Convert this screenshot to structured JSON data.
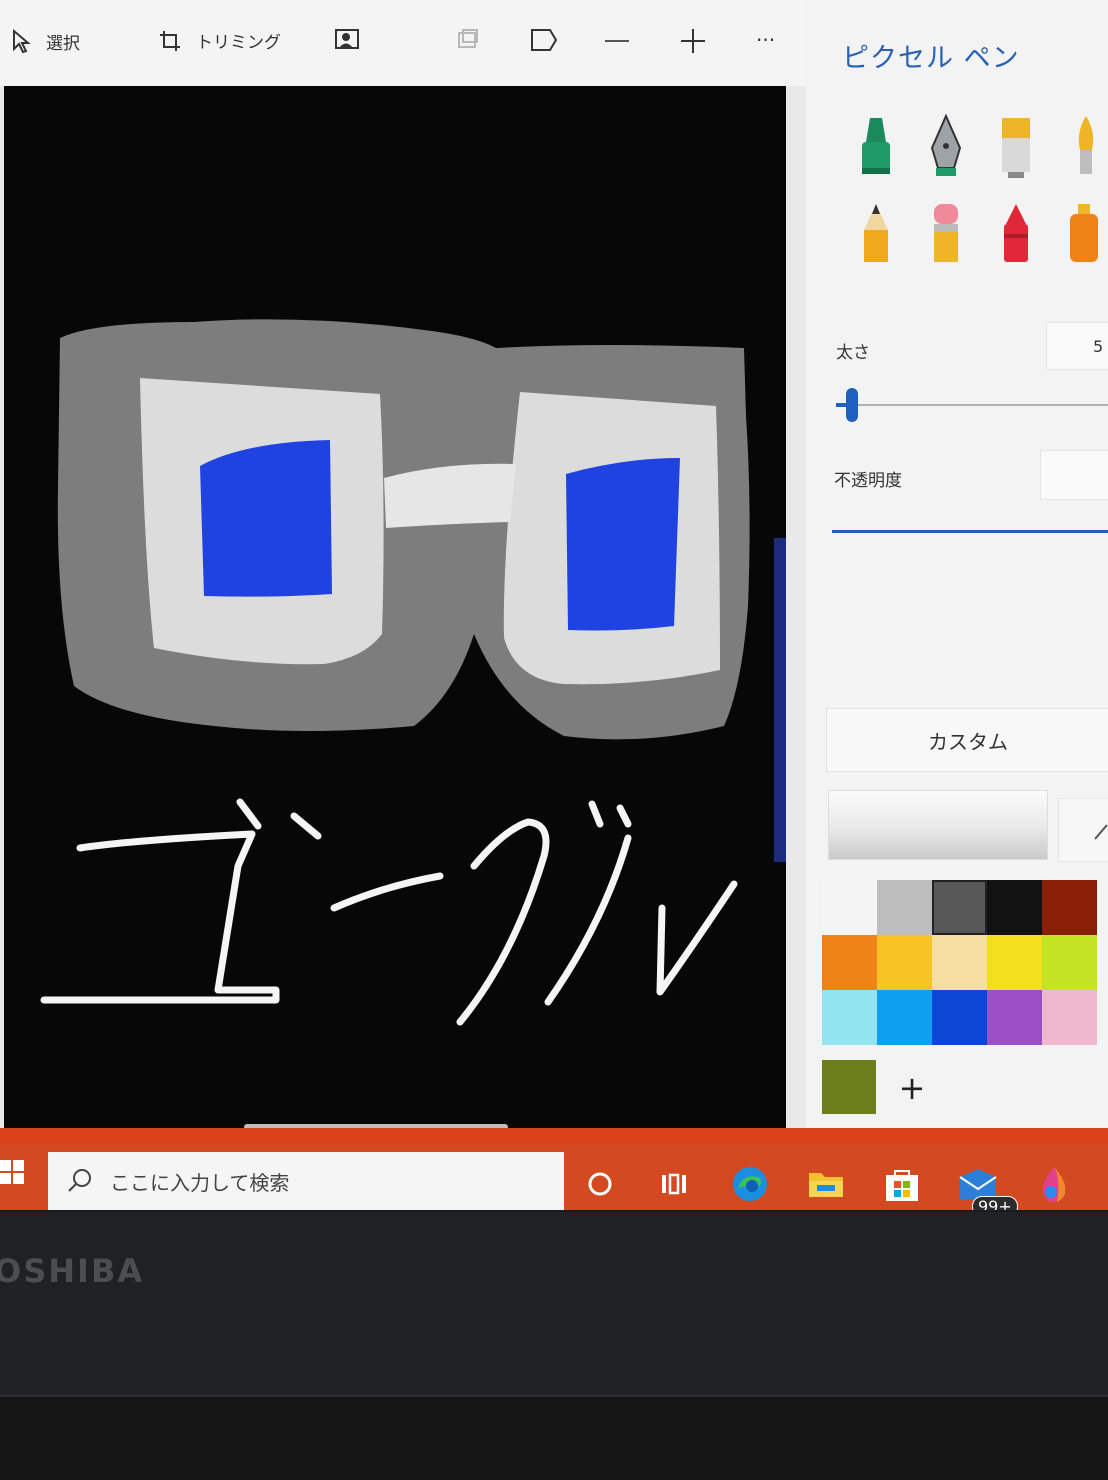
{
  "toolbar": {
    "select_label": "選択",
    "trim_label": "トリミング",
    "more_label": "···"
  },
  "canvas": {
    "handwritten_text": "ゴーグル",
    "lens_color": "#1f43e0",
    "frame_color": "#7d7d7d",
    "lens_frame_color": "#dcdcdc"
  },
  "panel": {
    "title": "ピクセル ペン",
    "brushes": [
      "marker-icon",
      "calligraphy-pen-icon",
      "oil-brush-icon",
      "watercolor-brush-icon",
      "pencil-icon",
      "eraser-icon",
      "crayon-icon",
      "spray-can-icon"
    ],
    "thickness_label": "太さ",
    "thickness_value": "5",
    "opacity_label": "不透明度",
    "custom_label": "カスタム",
    "palette": [
      "#f4f4f4",
      "#bdbdbd",
      "#585858",
      "#121212",
      "#8a1e06",
      "#f08317",
      "#f7c325",
      "#f5dfa0",
      "#f3e01d",
      "#c4e324",
      "#92e4ee",
      "#0e9ff0",
      "#0b47d4",
      "#9b50c8",
      "#f0b8cd"
    ],
    "selected_swatch": 2,
    "custom_color": "#6d7f1d",
    "add_label": "+"
  },
  "taskbar": {
    "search_placeholder": "ここに入力して検索",
    "mail_badge": "99+"
  },
  "bezel": {
    "brand": "OSHIBA"
  }
}
